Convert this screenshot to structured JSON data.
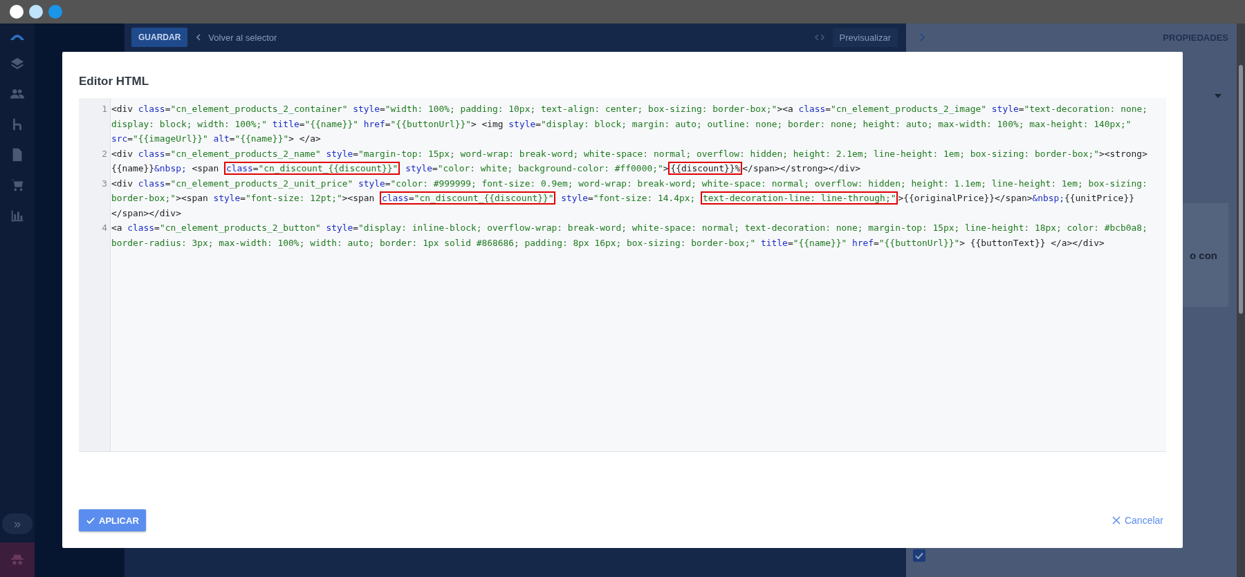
{
  "rail": {
    "collapse_label": "»"
  },
  "toolbar": {
    "save": "GUARDAR",
    "back": "Volver al selector",
    "preview": "Previsualizar"
  },
  "properties_panel": {
    "title": "PROPIEDADES",
    "card_text": "o con",
    "checkbox": {
      "checked": true
    }
  },
  "modal": {
    "title": "Editor HTML",
    "editor": {
      "lines": [
        {
          "number": "1",
          "parts": [
            {
              "text": "<div class=\"cn_element_products_2_container\" style=\"width: 100%; padding: 10px; text-align: center; box-sizing: border-box;\"><a class=\"cn_element_products_2_image\" style=\"text-decoration: none; display: block; width: 100%;\" title=\"{{name}}\" href=\"{{buttonUrl}}\"> <img style=\"display: block; margin: auto; outline: none; border: none; height: auto; max-width: 100%; max-height: 140px;\" src=\"{{imageUrl}}\" alt=\"{{name}}\"> </a>",
              "boxed": false
            }
          ]
        },
        {
          "number": "2",
          "parts": [
            {
              "text": "<div class=\"cn_element_products_2_name\" style=\"margin-top: 15px; word-wrap: break-word; white-space: normal; overflow: hidden; height: 2.1em; line-height: 1em; box-sizing: border-box;\"><strong>{{name}}&nbsp; <span ",
              "boxed": false
            },
            {
              "text": "class=\"cn_discount_{{discount}}\"",
              "boxed": true
            },
            {
              "text": " style=\"color: white; background-color: #ff0000;\">",
              "boxed": false
            },
            {
              "text": "{{discount}}%",
              "boxed": true
            },
            {
              "text": "</span></strong></div>",
              "boxed": false
            }
          ]
        },
        {
          "number": "3",
          "parts": [
            {
              "text": "<div class=\"cn_element_products_2_unit_price\" style=\"color: #999999; font-size: 0.9em; word-wrap: break-word; white-space: normal; overflow: hidden; height: 1.1em; line-height: 1em; box-sizing: border-box;\"><span style=\"font-size: 12pt;\"><span ",
              "boxed": false
            },
            {
              "text": "class=\"cn_discount_{{discount}}\"",
              "boxed": true
            },
            {
              "text": " style=\"font-size: 14.4px; ",
              "boxed": false
            },
            {
              "text": "text-decoration-line: line-through;\"",
              "boxed": true
            },
            {
              "text": ">{{originalPrice}}</span>&nbsp;{{unitPrice}}</span></div>",
              "boxed": false
            }
          ]
        },
        {
          "number": "4",
          "parts": [
            {
              "text": "<a class=\"cn_element_products_2_button\" style=\"display: inline-block; overflow-wrap: break-word; white-space: normal; text-decoration: none; margin-top: 15px; line-height: 18px; color: #bcb0a8; border-radius: 3px; max-width: 100%; width: auto; border: 1px solid #868686; padding: 8px 16px; box-sizing: border-box;\" title=\"{{name}}\" href=\"{{buttonUrl}}\"> {{buttonText}} </a></div>",
              "boxed": false
            }
          ]
        }
      ]
    },
    "apply": "APLICAR",
    "cancel": "Cancelar"
  }
}
